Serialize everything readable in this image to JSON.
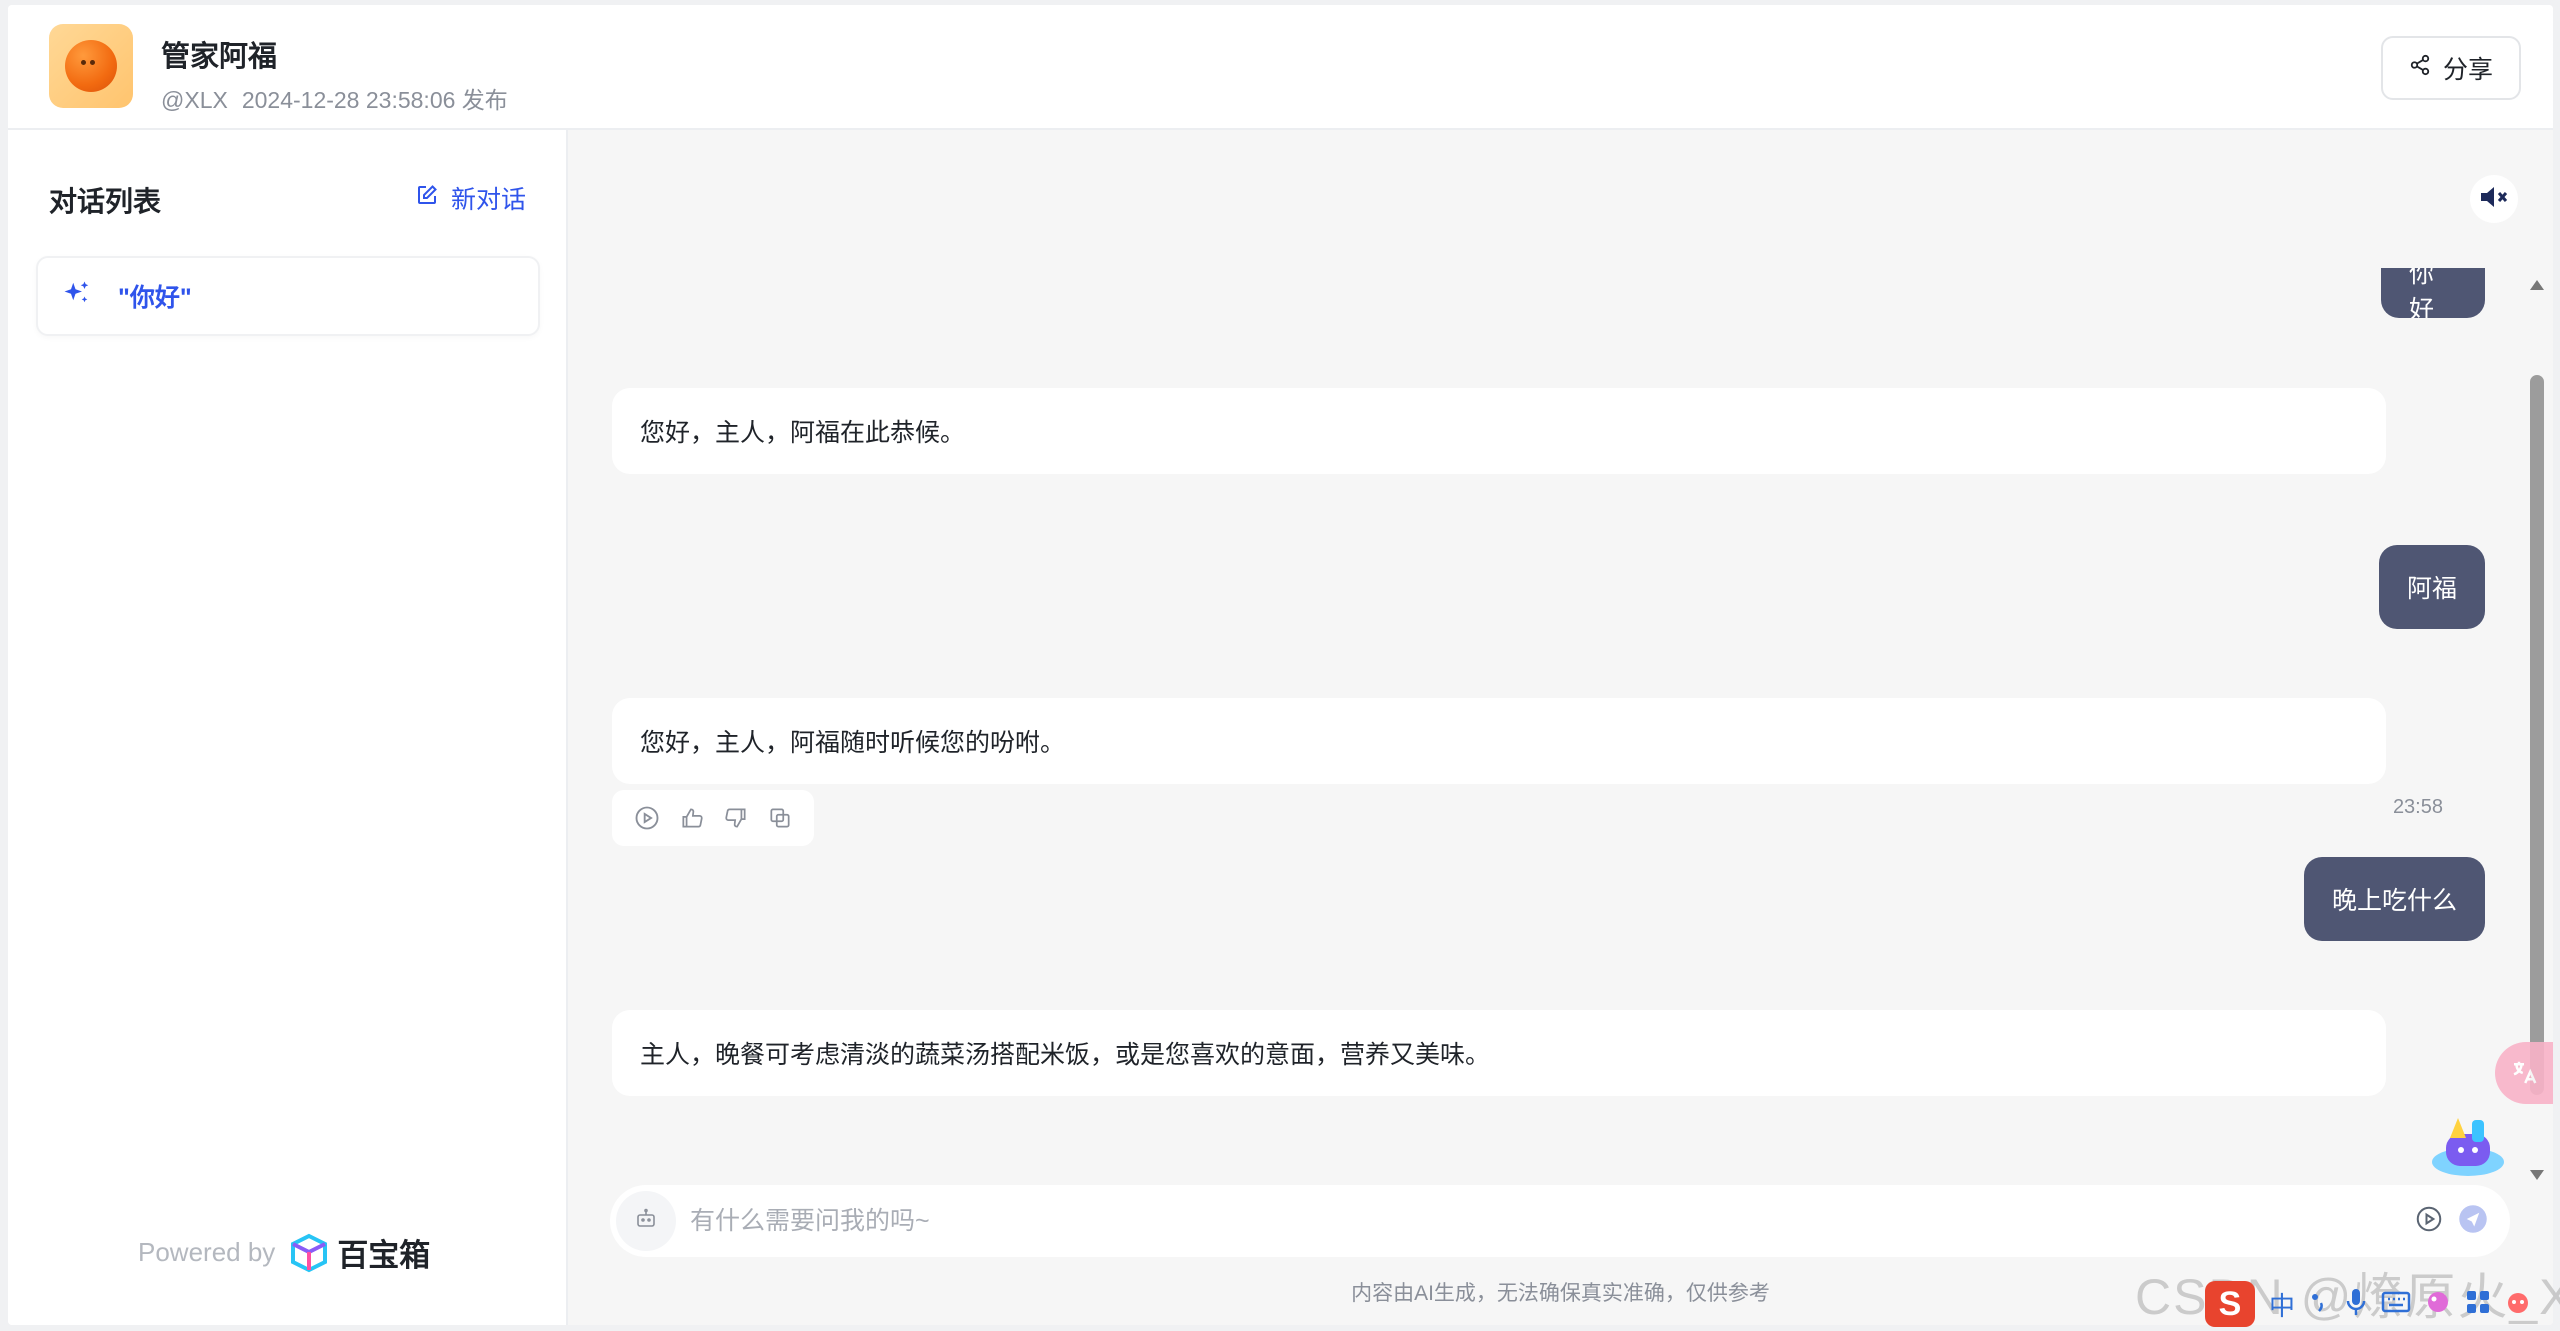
{
  "header": {
    "title": "管家阿福",
    "author": "@XLX",
    "published": "2024-12-28 23:58:06 发布",
    "share_label": "分享"
  },
  "sidebar": {
    "title": "对话列表",
    "new_chat_label": "新对话",
    "conversations": [
      {
        "label": "\"你好\""
      }
    ],
    "powered_by": "Powered by",
    "brand": "百宝箱"
  },
  "chat": {
    "partial_user_message": "你好",
    "messages": [
      {
        "role": "assistant",
        "text": "您好，主人，阿福在此恭候。"
      },
      {
        "role": "user",
        "text": "阿福"
      },
      {
        "role": "assistant",
        "text": "您好，主人，阿福随时听候您的吩咐。"
      },
      {
        "role": "user",
        "text": "晚上吃什么"
      },
      {
        "role": "assistant",
        "text": "主人，晚餐可考虑清淡的蔬菜汤搭配米饭，或是您喜欢的意面，营养又美味。"
      }
    ],
    "timestamp": "23:58"
  },
  "input": {
    "placeholder": "有什么需要问我的吗~",
    "value": ""
  },
  "disclaimer": "内容由AI生成，无法确保真实准确，仅供参考",
  "watermark": "CSDN @燎原火_Xu",
  "ime": {
    "logo": "S",
    "lang": "中"
  },
  "colors": {
    "accent": "#2f54eb",
    "user_bubble": "#4f5673",
    "background": "#f6f6f6"
  }
}
